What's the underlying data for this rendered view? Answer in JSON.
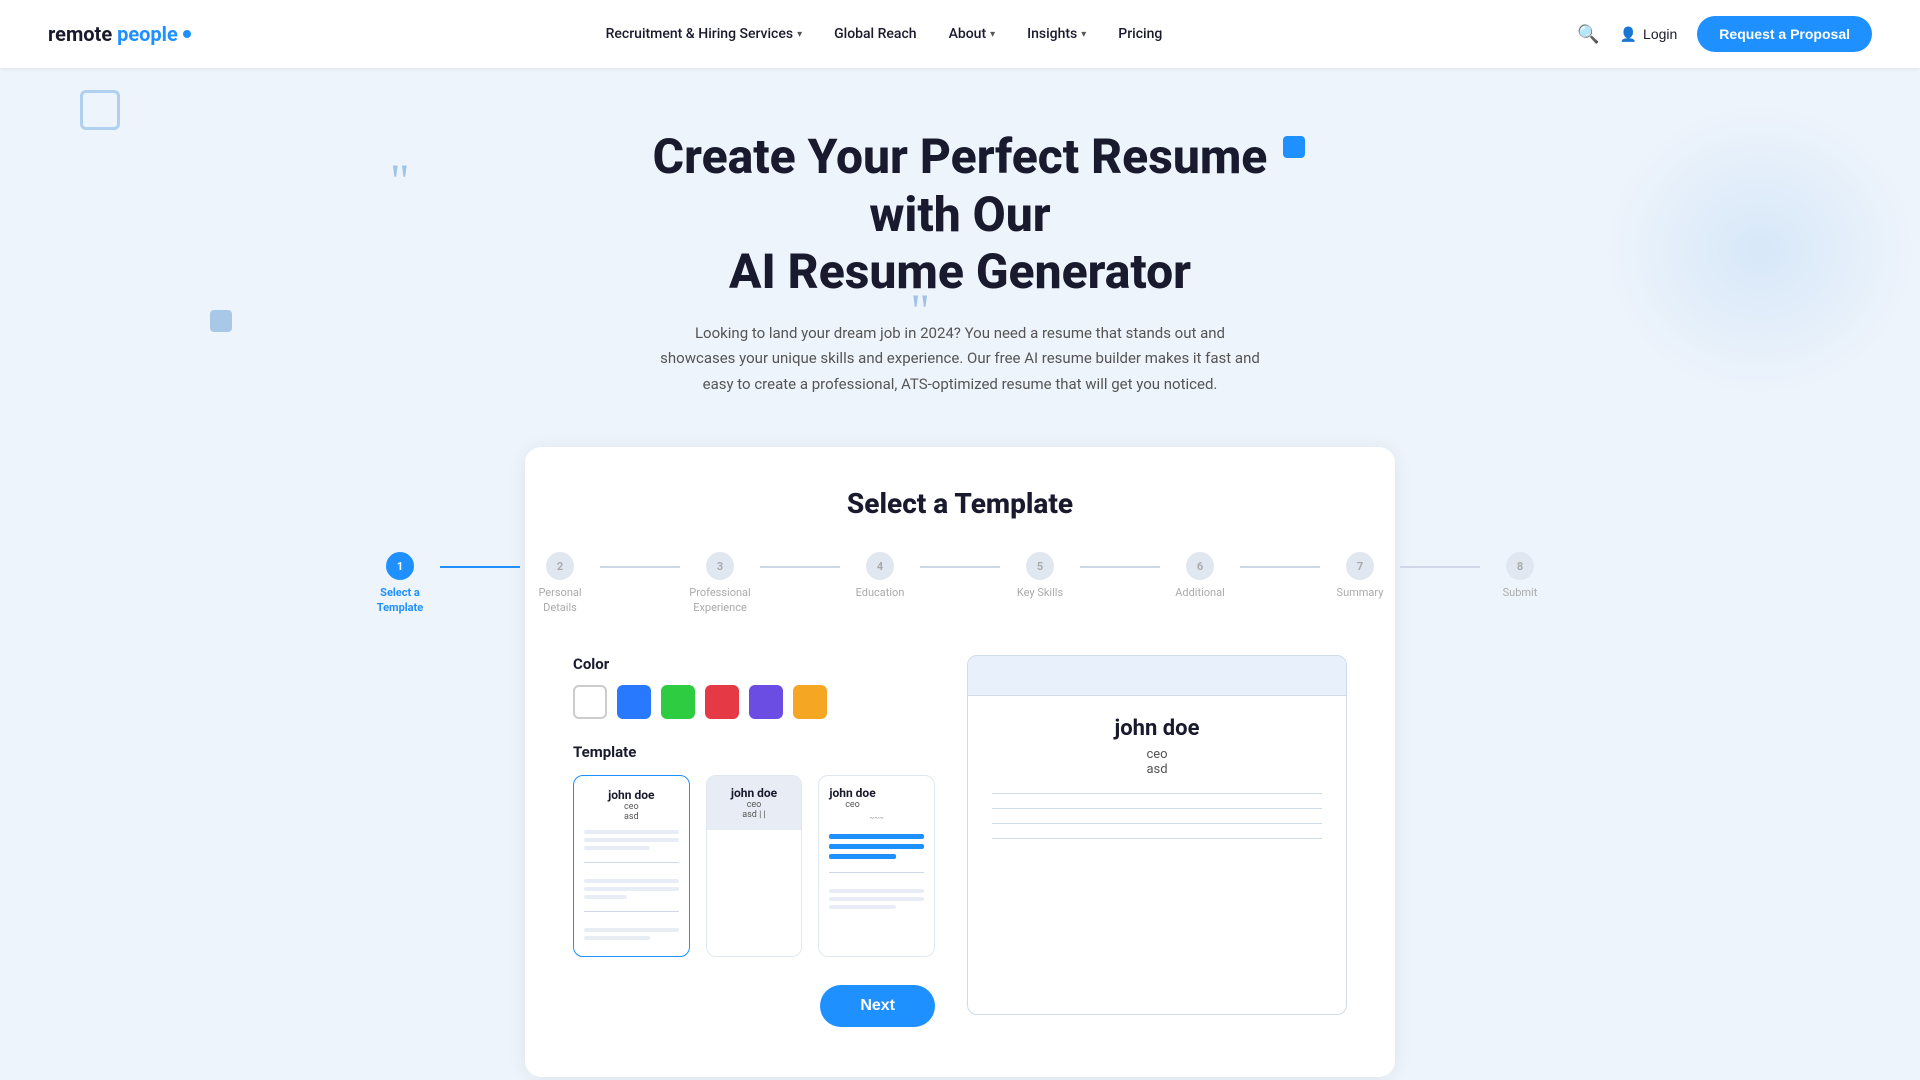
{
  "brand": {
    "logo_text": "remote people",
    "logo_accent": "people"
  },
  "nav": {
    "items": [
      {
        "label": "Recruitment & Hiring Services",
        "has_dropdown": true
      },
      {
        "label": "Global Reach",
        "has_dropdown": false
      },
      {
        "label": "About",
        "has_dropdown": true
      },
      {
        "label": "Insights",
        "has_dropdown": true
      },
      {
        "label": "Pricing",
        "has_dropdown": false
      }
    ],
    "login_label": "Login",
    "request_btn": "Request a Proposal"
  },
  "hero": {
    "title_line1": "Create Your Perfect Resume with Our",
    "title_line2": "AI Resume Generator",
    "subtitle": "Looking to land your dream job in 2024? You need a resume that stands out and showcases your unique skills and experience. Our free AI resume builder makes it fast and easy to create a professional, ATS-optimized resume that will get you noticed."
  },
  "card": {
    "title": "Select a Template",
    "stepper": [
      {
        "number": "1",
        "label": "Select a\nTemplate",
        "active": true
      },
      {
        "number": "2",
        "label": "Personal\nDetails",
        "active": false
      },
      {
        "number": "3",
        "label": "Professional\nExperience",
        "active": false
      },
      {
        "number": "4",
        "label": "Education",
        "active": false
      },
      {
        "number": "5",
        "label": "Key Skills",
        "active": false
      },
      {
        "number": "6",
        "label": "Additional",
        "active": false
      },
      {
        "number": "7",
        "label": "Summary",
        "active": false
      },
      {
        "number": "8",
        "label": "Submit",
        "active": false
      }
    ],
    "color_label": "Color",
    "colors": [
      {
        "name": "white",
        "class": "white",
        "selected": true
      },
      {
        "name": "blue",
        "class": "blue",
        "selected": false
      },
      {
        "name": "green",
        "class": "green",
        "selected": false
      },
      {
        "name": "red",
        "class": "red",
        "selected": false
      },
      {
        "name": "purple",
        "class": "purple",
        "selected": false
      },
      {
        "name": "orange",
        "class": "orange",
        "selected": false
      }
    ],
    "template_label": "Template",
    "templates": [
      {
        "id": 1,
        "selected": true
      },
      {
        "id": 2,
        "selected": false
      },
      {
        "id": 3,
        "selected": false
      }
    ],
    "preview": {
      "name": "john doe",
      "role": "ceo",
      "location": "asd"
    },
    "next_btn": "Next"
  }
}
